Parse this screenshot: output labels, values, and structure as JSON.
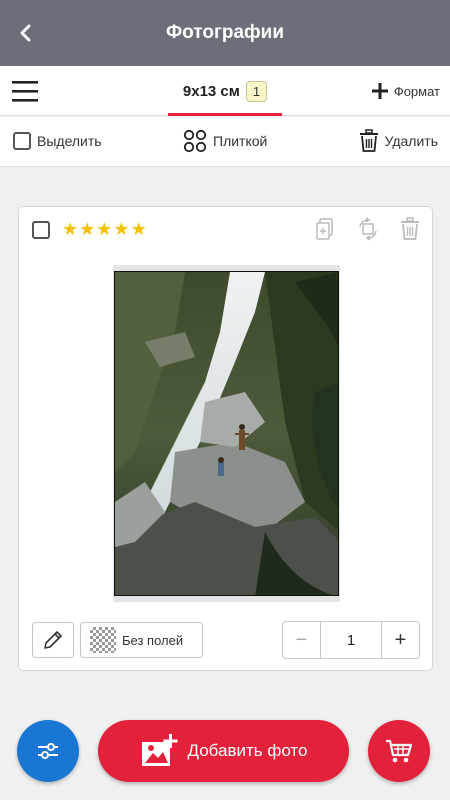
{
  "app_bar": {
    "title": "Фотографии",
    "back_icon": "arrow-left-icon"
  },
  "format_bar": {
    "menu_icon": "hamburger-menu-icon",
    "active_format": {
      "label": "9x13 см",
      "count": "1"
    },
    "add_format_label": "Формат",
    "add_format_icon": "plus-icon",
    "accent_color": "#e4213b"
  },
  "toolbar": {
    "select_label": "Выделить",
    "tile_label": "Плиткой",
    "tile_icon": "grid-circles-icon",
    "delete_label": "Удалить",
    "delete_icon": "trash-icon"
  },
  "photo_card": {
    "checked": false,
    "rating": 5,
    "max_rating": 5,
    "star_color": "#f2c200",
    "actions": [
      "duplicate-icon",
      "rotate-icon",
      "trash-icon"
    ],
    "edit_icon": "pencil-icon",
    "fields_label": "Без полей",
    "fields_icon": "checkerboard-icon",
    "quantity": "1",
    "minus_label": "−",
    "plus_label": "+"
  },
  "bottom_bar": {
    "filter_icon": "sliders-icon",
    "add_photo_label": "Добавить фото",
    "add_photo_icon": "add-image-icon",
    "cart_icon": "cart-icon",
    "filter_color": "#1976d2",
    "primary_color": "#e4213b"
  }
}
